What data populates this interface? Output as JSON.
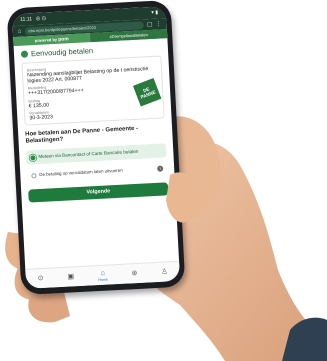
{
  "status_bar": {
    "time": "11:11",
    "icons_left": "◎ ◷",
    "icons_right": "▾ ▮"
  },
  "browser": {
    "url": "ebo.epm.be/dp/depanne/betalen/2023",
    "home_icon": "home-icon",
    "tabs_icon": "tabs-icon"
  },
  "brand_bar": {
    "left_prefix": "powered by",
    "left_brand": "pom",
    "right_text": "#DrempelloosBetalen"
  },
  "page": {
    "title": "Eenvoudig betalen",
    "fields": [
      {
        "label": "Beschrijving",
        "value": "Nazending aanslagbiljet Belasting op de t oeristische logies 2022 Art. 000877"
      },
      {
        "label": "Mededeling",
        "value": "+++317/2000/87794+++"
      },
      {
        "label": "Bedrag",
        "value": "€ 135,00"
      },
      {
        "label": "Vervaldatum",
        "value": "30-3-2023"
      }
    ],
    "logo_text": "DE PANNE",
    "question": "Hoe betalen aan De Panne - Gemeente - Belastingen?",
    "options": [
      {
        "label": "Meteen via Bancontact of Carte Bancaire betalen",
        "selected": true
      },
      {
        "label": "De betaling op vervaldatum laten uitvoeren",
        "selected": false
      }
    ],
    "info_glyph": "i",
    "next_button": "Volgende"
  },
  "tabbar": [
    {
      "glyph": "⊙",
      "label": "",
      "active": false
    },
    {
      "glyph": "▣",
      "label": "",
      "active": false
    },
    {
      "glyph": "⌂",
      "label": "Home",
      "active": true
    },
    {
      "glyph": "⊛",
      "label": "",
      "active": false
    },
    {
      "glyph": "♙",
      "label": "",
      "active": false
    }
  ],
  "colors": {
    "brand_green": "#1f7a3e",
    "header_dark": "#1e3d2e",
    "selected_bg": "#e3f1e6"
  }
}
